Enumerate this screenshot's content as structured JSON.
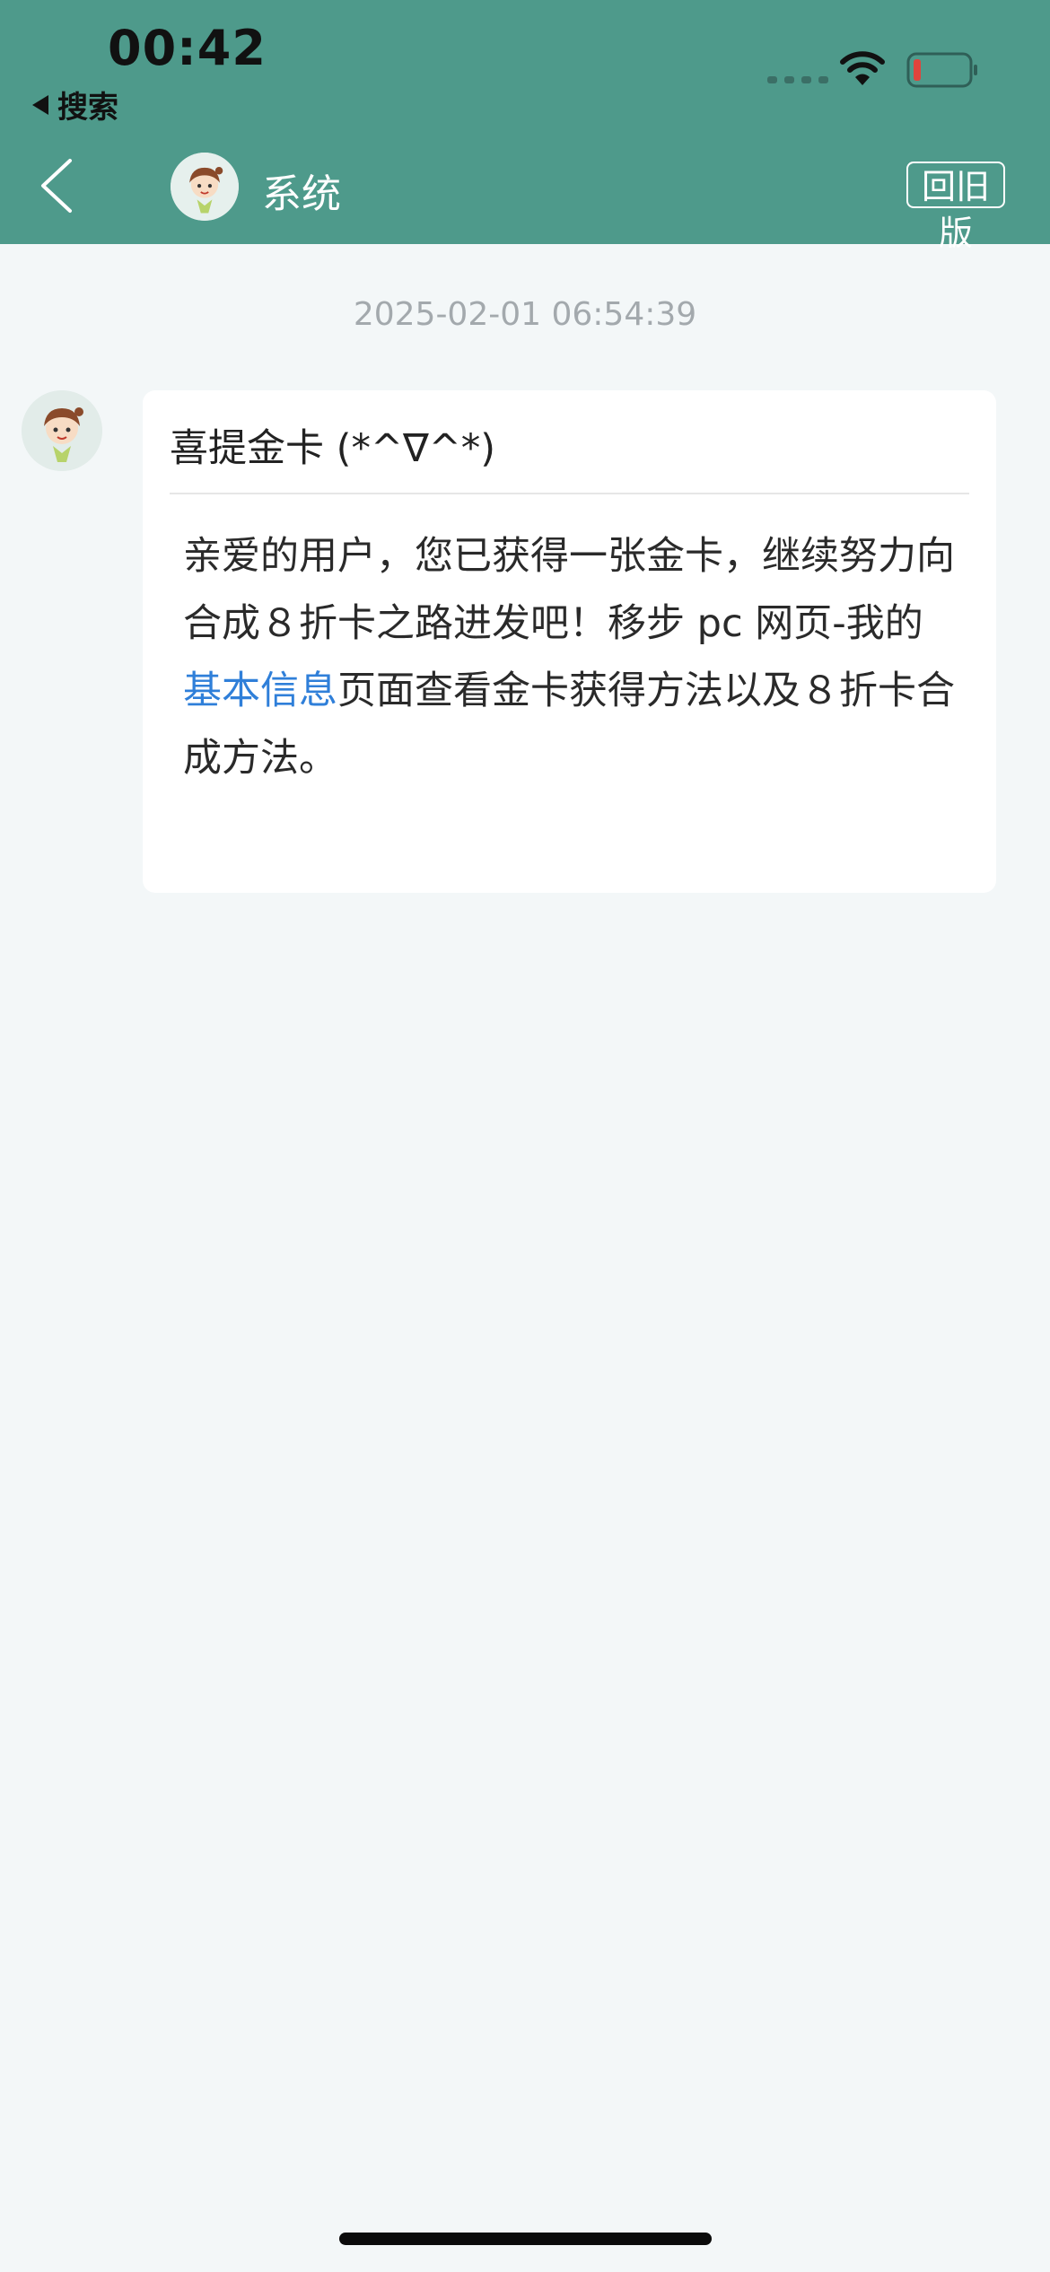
{
  "status_bar": {
    "time": "00:42",
    "back_app": "搜索"
  },
  "nav": {
    "title": "系统",
    "old_version": "回旧版"
  },
  "message": {
    "timestamp": "2025-02-01 06:54:39",
    "title": "喜提金卡 (*^∇^*)",
    "body_before_link": "亲爱的用户，您已获得一张金卡，继续努力向合成８折卡之路进发吧！移步 pc 网页-我的",
    "body_link": "基本信息",
    "body_after_link": "页面查看金卡获得方法以及８折卡合成方法。"
  },
  "colors": {
    "header_bg": "#4e9a8b",
    "page_bg": "#f3f7f8",
    "link": "#2f7fd9"
  },
  "icons": {
    "back": "chevron-left-icon",
    "wifi": "wifi-icon",
    "battery": "battery-low-icon",
    "signal": "cellular-signal-icon"
  }
}
